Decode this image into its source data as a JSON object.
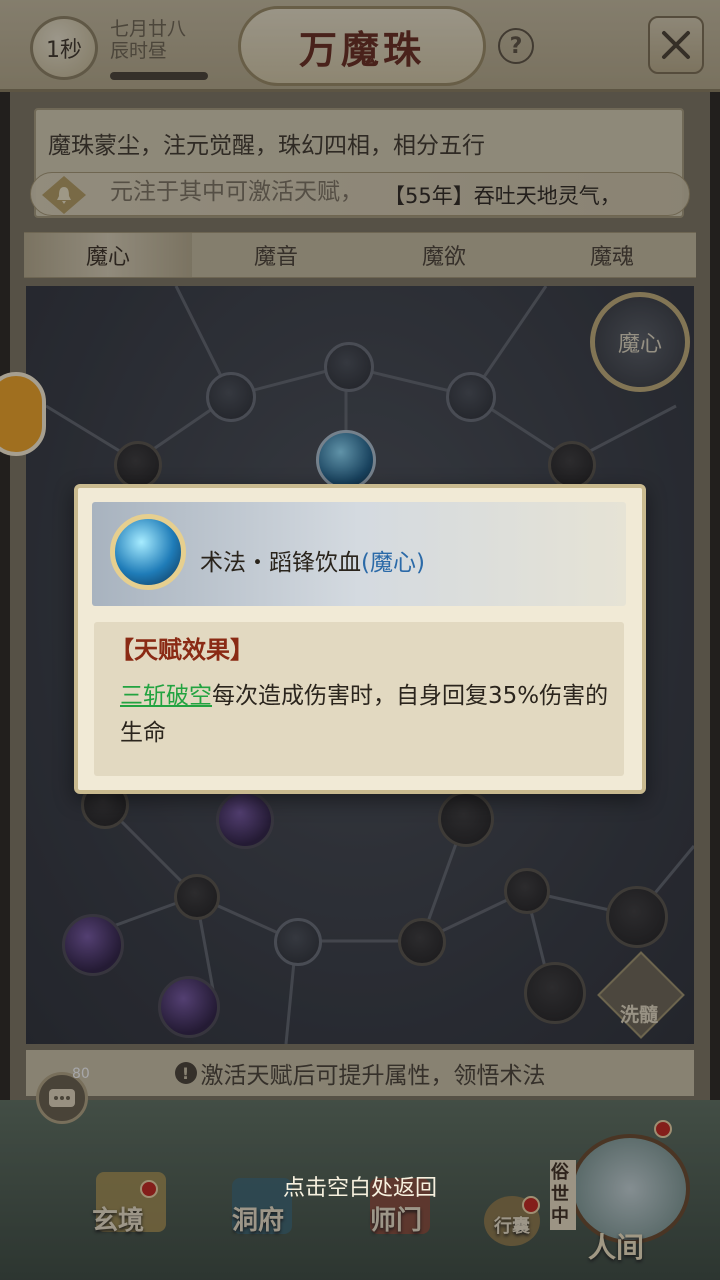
{
  "header": {
    "timer": "1秒",
    "date_line1": "七月廿八",
    "date_line2": "辰时昼",
    "title": "万魔珠",
    "help": "?"
  },
  "info": {
    "line1": "魔珠蒙尘，注元觉醒，珠幻四相，相分五行",
    "line2": "元注于其中可激活天赋，"
  },
  "marquee": {
    "text": "【55年】吞吐天地灵气，"
  },
  "tabs": [
    "魔心",
    "魔音",
    "魔欲",
    "魔魂"
  ],
  "tree": {
    "badge_label": "魔心",
    "wash_label": "洗髓"
  },
  "hint": {
    "icon": "!",
    "text": "激活天赋后可提升属性，领悟术法"
  },
  "chat": {
    "count": "80"
  },
  "return_hint": "点击空白处返回",
  "nav": {
    "xuanjing": "玄境",
    "dongfu": "洞府",
    "shimen": "师门",
    "xingnang": "行囊",
    "renjian": "人间",
    "sushizhong": "俗世中"
  },
  "popup": {
    "skill_name": "术法・蹈锋饮血",
    "skill_tag": "(魔心)",
    "effect_title": "【天赋效果】",
    "effect_link": "三斩破空",
    "effect_text": "每次造成伤害时，自身回复35%伤害的生命"
  },
  "colors": {
    "title_red": "#6a2a1c",
    "effect_title": "#8a2a14",
    "link_green": "#22a340",
    "tag_blue": "#2b6aa8"
  }
}
